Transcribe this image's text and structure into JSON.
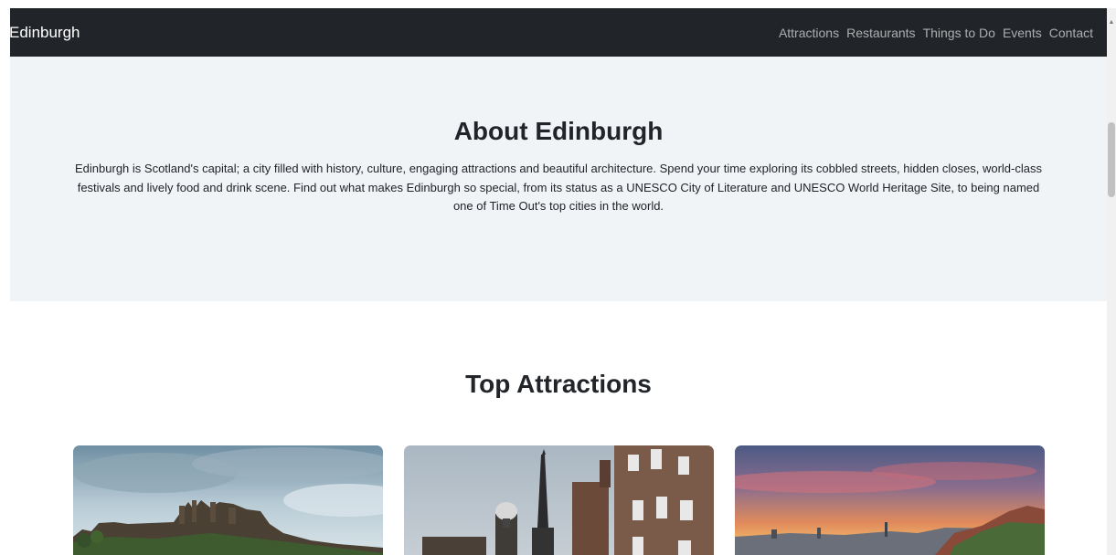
{
  "navbar": {
    "brand": "Edinburgh",
    "links": [
      "Attractions",
      "Restaurants",
      "Things to Do",
      "Events",
      "Contact"
    ]
  },
  "about": {
    "title": "About Edinburgh",
    "text": "Edinburgh is Scotland's capital; a city filled with history, culture, engaging attractions and beautiful architecture. Spend your time exploring its cobbled streets, hidden closes, world-class festivals and lively food and drink scene. Find out what makes Edinburgh so special, from its status as a UNESCO City of Literature and UNESCO World Heritage Site, to being named one of Time Out's top cities in the world."
  },
  "attractions": {
    "title": "Top Attractions"
  },
  "colors": {
    "navbar_bg": "#212529",
    "about_bg": "#f0f4f7"
  }
}
